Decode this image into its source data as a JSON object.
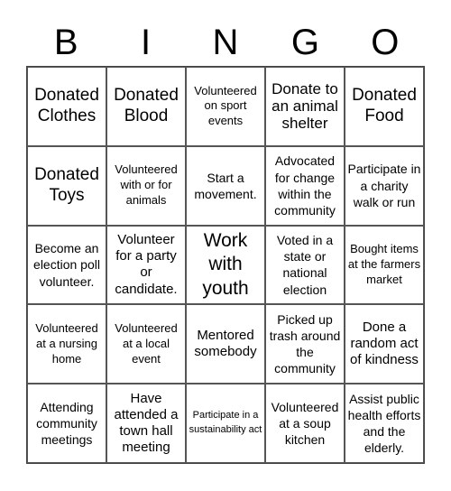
{
  "header": [
    "B",
    "I",
    "N",
    "G",
    "O"
  ],
  "cells": [
    [
      "Donated Clothes",
      "Donated Blood",
      "Volunteered on sport events",
      "Donate to an animal shelter",
      "Donated Food"
    ],
    [
      "Donated Toys",
      "Volunteered with or for animals",
      "Start a movement.",
      "Advocated for change within the community",
      "Participate in a charity walk or run"
    ],
    [
      "Become an election poll volunteer.",
      "Volunteer for a party or candidate.",
      "Work with youth",
      "Voted in a state or national election",
      "Bought items at the farmers market"
    ],
    [
      "Volunteered at a nursing home",
      "Volunteered at a local event",
      "Mentored somebody",
      "Picked up trash around the community",
      "Done a random act of kindness"
    ],
    [
      "Attending community meetings",
      "Have attended a town hall meeting",
      "Participate in a sustainability act",
      "Volunteered at a soup kitchen",
      "Assist public health efforts and the elderly."
    ]
  ]
}
